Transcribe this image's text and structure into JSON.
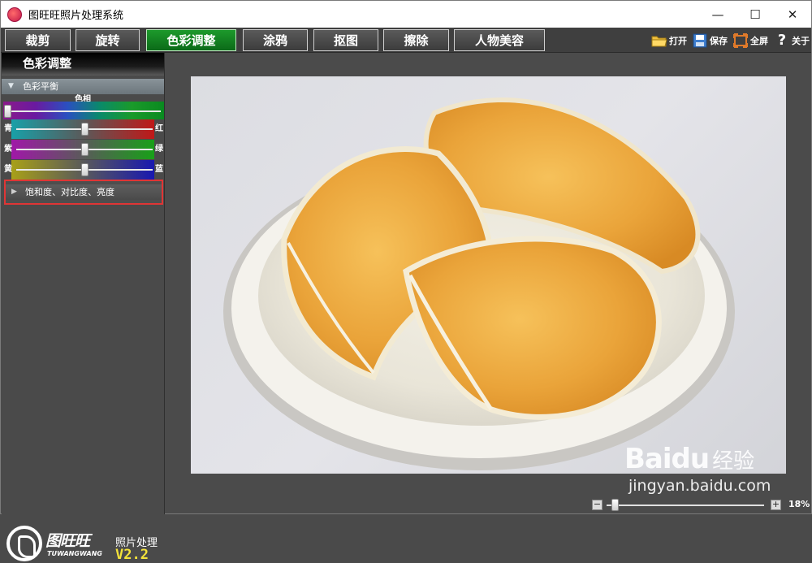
{
  "window": {
    "title": "图旺旺照片处理系统",
    "controls": {
      "minimize": "—",
      "maximize": "☐",
      "close": "✕"
    }
  },
  "toolbar": {
    "tabs": [
      {
        "label": "裁剪"
      },
      {
        "label": "旋转"
      },
      {
        "label": "色彩调整",
        "active": true
      },
      {
        "label": "涂鸦"
      },
      {
        "label": "抠图"
      },
      {
        "label": "擦除"
      },
      {
        "label": "人物美容"
      }
    ],
    "actions": [
      {
        "label": "打开",
        "icon": "folder-icon"
      },
      {
        "label": "保存",
        "icon": "save-icon"
      },
      {
        "label": "全屏",
        "icon": "fullscreen-icon"
      },
      {
        "label": "关于",
        "icon": "help-icon"
      }
    ],
    "active_color": "#0e7a1d"
  },
  "left_panel": {
    "title": "色彩调整",
    "color_balance": {
      "header": "色彩平衡",
      "hue_label": "色相",
      "sliders": [
        {
          "left": "青",
          "right": "红",
          "value": 0.5
        },
        {
          "left": "紫",
          "right": "绿",
          "value": 0.5
        },
        {
          "left": "黄",
          "right": "蓝",
          "value": 0.5
        }
      ],
      "hue_value": 0.0
    },
    "saturation_header": "饱和度、对比度、亮度"
  },
  "logo": {
    "brand": "图旺旺",
    "sub": "TUWANGWANG",
    "tag": "照片处理",
    "version": "V2.2"
  },
  "statusbar": {
    "zoom_minus": "−",
    "zoom_plus": "+",
    "zoom_percent": "18%",
    "zoom_value": 0.03
  },
  "watermark": {
    "logo": "Bai",
    "logo2": "du",
    "cn": "经验",
    "url": "jingyan.baidu.com"
  }
}
